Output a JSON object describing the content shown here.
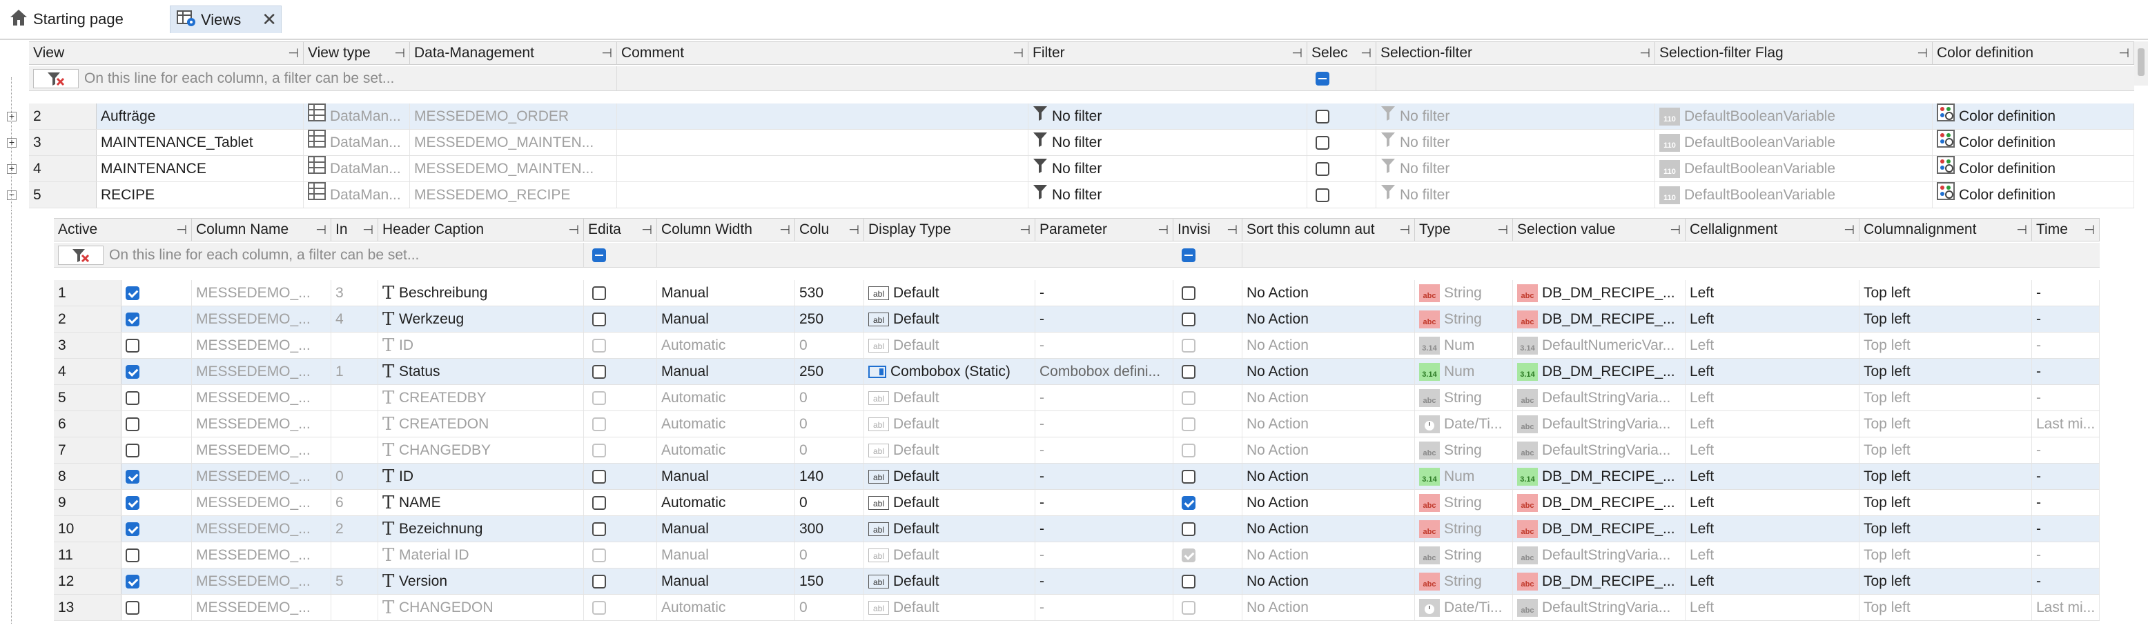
{
  "tabs": [
    {
      "label": "Starting page",
      "icon": "home-icon"
    },
    {
      "label": "Views",
      "icon": "views-icon",
      "close": "✕"
    }
  ],
  "views_grid": {
    "columns": [
      "View",
      "View type",
      "Data-Management",
      "Comment",
      "Filter",
      "Selec",
      "Selection-filter",
      "Selection-filter Flag",
      "Color definition"
    ],
    "filter_hint": "On this line for each column, a filter can be set...",
    "rows": [
      {
        "num": "2",
        "view": "Aufträge",
        "view_type": "DataMan...",
        "data_mgmt": "MESSEDEMO_ORDER",
        "comment": "",
        "filter": "No filter",
        "sel_filter": "No filter",
        "sel_flag": "DefaultBooleanVariable",
        "color_def": "Color definition"
      },
      {
        "num": "3",
        "view": "MAINTENANCE_Tablet",
        "view_type": "DataMan...",
        "data_mgmt": "MESSEDEMO_MAINTEN...",
        "comment": "",
        "filter": "No filter",
        "sel_filter": "No filter",
        "sel_flag": "DefaultBooleanVariable",
        "color_def": "Color definition"
      },
      {
        "num": "4",
        "view": "MAINTENANCE",
        "view_type": "DataMan...",
        "data_mgmt": "MESSEDEMO_MAINTEN...",
        "comment": "",
        "filter": "No filter",
        "sel_filter": "No filter",
        "sel_flag": "DefaultBooleanVariable",
        "color_def": "Color definition"
      },
      {
        "num": "5",
        "view": "RECIPE",
        "view_type": "DataMan...",
        "data_mgmt": "MESSEDEMO_RECIPE",
        "comment": "",
        "filter": "No filter",
        "sel_filter": "No filter",
        "sel_flag": "DefaultBooleanVariable",
        "color_def": "Color definition"
      }
    ]
  },
  "columns_grid": {
    "columns": [
      "Active",
      "Column Name",
      "In",
      "Header Caption",
      "Edita",
      "Column Width",
      "Colu",
      "Display Type",
      "Parameter",
      "Invisi",
      "Sort this column aut",
      "Type",
      "Selection value",
      "Cellalignment",
      "Columnalignment",
      "Time"
    ],
    "filter_hint": "On this line for each column, a filter can be set...",
    "rows": [
      {
        "num": "1",
        "active": true,
        "colname": "MESSEDEMO_...",
        "in": "3",
        "caption": "Beschreibung",
        "edit": false,
        "cw": "Manual",
        "colu": "530",
        "dtype": "Default",
        "dicon": "abl",
        "param": "-",
        "invis": false,
        "sort": "No Action",
        "type": "String",
        "tbadge": "abc",
        "selval": "DB_DM_RECIPE_...",
        "sbadge": "abc",
        "cell": "Left",
        "colalign": "Top left",
        "time": "-",
        "dim": false
      },
      {
        "num": "2",
        "active": true,
        "colname": "MESSEDEMO_...",
        "in": "4",
        "caption": "Werkzeug",
        "edit": false,
        "cw": "Manual",
        "colu": "250",
        "dtype": "Default",
        "dicon": "abl",
        "param": "-",
        "invis": false,
        "sort": "No Action",
        "type": "String",
        "tbadge": "abc",
        "selval": "DB_DM_RECIPE_...",
        "sbadge": "abc",
        "cell": "Left",
        "colalign": "Top left",
        "time": "-",
        "dim": false
      },
      {
        "num": "3",
        "active": false,
        "colname": "MESSEDEMO_...",
        "in": "",
        "caption": "ID",
        "edit": false,
        "cw": "Automatic",
        "colu": "0",
        "dtype": "Default",
        "dicon": "abl",
        "param": "-",
        "invis": false,
        "sort": "No Action",
        "type": "Num",
        "tbadge": "3.14",
        "selval": "DefaultNumericVar...",
        "sbadge": "3.14",
        "cell": "Left",
        "colalign": "Top left",
        "time": "-",
        "dim": true
      },
      {
        "num": "4",
        "active": true,
        "colname": "MESSEDEMO_...",
        "in": "1",
        "caption": "Status",
        "edit": false,
        "cw": "Manual",
        "colu": "250",
        "dtype": "Combobox (Static)",
        "dicon": "combo",
        "param": "Combobox defini...",
        "invis": false,
        "sort": "No Action",
        "type": "Num",
        "tbadge": "3.14",
        "selval": "DB_DM_RECIPE_...",
        "sbadge": "3.14",
        "cell": "Left",
        "colalign": "Top left",
        "time": "-",
        "dim": false
      },
      {
        "num": "5",
        "active": false,
        "colname": "MESSEDEMO_...",
        "in": "",
        "caption": "CREATEDBY",
        "edit": false,
        "cw": "Automatic",
        "colu": "0",
        "dtype": "Default",
        "dicon": "abl",
        "param": "-",
        "invis": false,
        "sort": "No Action",
        "type": "String",
        "tbadge": "abc",
        "selval": "DefaultStringVaria...",
        "sbadge": "abc",
        "cell": "Left",
        "colalign": "Top left",
        "time": "-",
        "dim": true
      },
      {
        "num": "6",
        "active": false,
        "colname": "MESSEDEMO_...",
        "in": "",
        "caption": "CREATEDON",
        "edit": false,
        "cw": "Automatic",
        "colu": "0",
        "dtype": "Default",
        "dicon": "abl",
        "param": "-",
        "invis": false,
        "sort": "No Action",
        "type": "Date/Ti...",
        "tbadge": "dt",
        "selval": "DefaultStringVaria...",
        "sbadge": "abc",
        "cell": "Left",
        "colalign": "Top left",
        "time": "Last mi...",
        "dim": true
      },
      {
        "num": "7",
        "active": false,
        "colname": "MESSEDEMO_...",
        "in": "",
        "caption": "CHANGEDBY",
        "edit": false,
        "cw": "Automatic",
        "colu": "0",
        "dtype": "Default",
        "dicon": "abl",
        "param": "-",
        "invis": false,
        "sort": "No Action",
        "type": "String",
        "tbadge": "abc",
        "selval": "DefaultStringVaria...",
        "sbadge": "abc",
        "cell": "Left",
        "colalign": "Top left",
        "time": "-",
        "dim": true
      },
      {
        "num": "8",
        "active": true,
        "colname": "MESSEDEMO_...",
        "in": "0",
        "caption": "ID",
        "edit": false,
        "cw": "Manual",
        "colu": "140",
        "dtype": "Default",
        "dicon": "abl",
        "param": "-",
        "invis": false,
        "sort": "No Action",
        "type": "Num",
        "tbadge": "3.14",
        "selval": "DB_DM_RECIPE_...",
        "sbadge": "3.14",
        "cell": "Left",
        "colalign": "Top left",
        "time": "-",
        "dim": false
      },
      {
        "num": "9",
        "active": true,
        "colname": "MESSEDEMO_...",
        "in": "6",
        "caption": "NAME",
        "edit": false,
        "cw": "Automatic",
        "colu": "0",
        "dtype": "Default",
        "dicon": "abl",
        "param": "-",
        "invis": true,
        "sort": "No Action",
        "type": "String",
        "tbadge": "abc",
        "selval": "DB_DM_RECIPE_...",
        "sbadge": "abc",
        "cell": "Left",
        "colalign": "Top left",
        "time": "-",
        "dim": false
      },
      {
        "num": "10",
        "active": true,
        "colname": "MESSEDEMO_...",
        "in": "2",
        "caption": "Bezeichnung",
        "edit": false,
        "cw": "Manual",
        "colu": "300",
        "dtype": "Default",
        "dicon": "abl",
        "param": "-",
        "invis": false,
        "sort": "No Action",
        "type": "String",
        "tbadge": "abc",
        "selval": "DB_DM_RECIPE_...",
        "sbadge": "abc",
        "cell": "Left",
        "colalign": "Top left",
        "time": "-",
        "dim": false
      },
      {
        "num": "11",
        "active": false,
        "colname": "MESSEDEMO_...",
        "in": "",
        "caption": "Material ID",
        "edit": false,
        "cw": "Manual",
        "colu": "0",
        "dtype": "Default",
        "dicon": "abl",
        "param": "-",
        "invis": true,
        "sort": "No Action",
        "type": "String",
        "tbadge": "abc",
        "selval": "DefaultStringVaria...",
        "sbadge": "abc",
        "cell": "Left",
        "colalign": "Top left",
        "time": "-",
        "dim": true
      },
      {
        "num": "12",
        "active": true,
        "colname": "MESSEDEMO_...",
        "in": "5",
        "caption": "Version",
        "edit": false,
        "cw": "Manual",
        "colu": "150",
        "dtype": "Default",
        "dicon": "abl",
        "param": "-",
        "invis": false,
        "sort": "No Action",
        "type": "String",
        "tbadge": "abc",
        "selval": "DB_DM_RECIPE_...",
        "sbadge": "abc",
        "cell": "Left",
        "colalign": "Top left",
        "time": "-",
        "dim": false
      },
      {
        "num": "13",
        "active": false,
        "colname": "MESSEDEMO_...",
        "in": "",
        "caption": "CHANGEDON",
        "edit": false,
        "cw": "Automatic",
        "colu": "0",
        "dtype": "Default",
        "dicon": "abl",
        "param": "-",
        "invis": false,
        "sort": "No Action",
        "type": "Date/Ti...",
        "tbadge": "dt",
        "selval": "DefaultStringVaria...",
        "sbadge": "abc",
        "cell": "Left",
        "colalign": "Top left",
        "time": "Last mi...",
        "dim": true
      }
    ]
  },
  "colors": {
    "accent": "#1f6fd0",
    "selected_row": "#e5eef8",
    "header_bg": "#f1f1f1",
    "string_badge": "#f2a9a9",
    "num_badge": "#a7e7a0"
  }
}
